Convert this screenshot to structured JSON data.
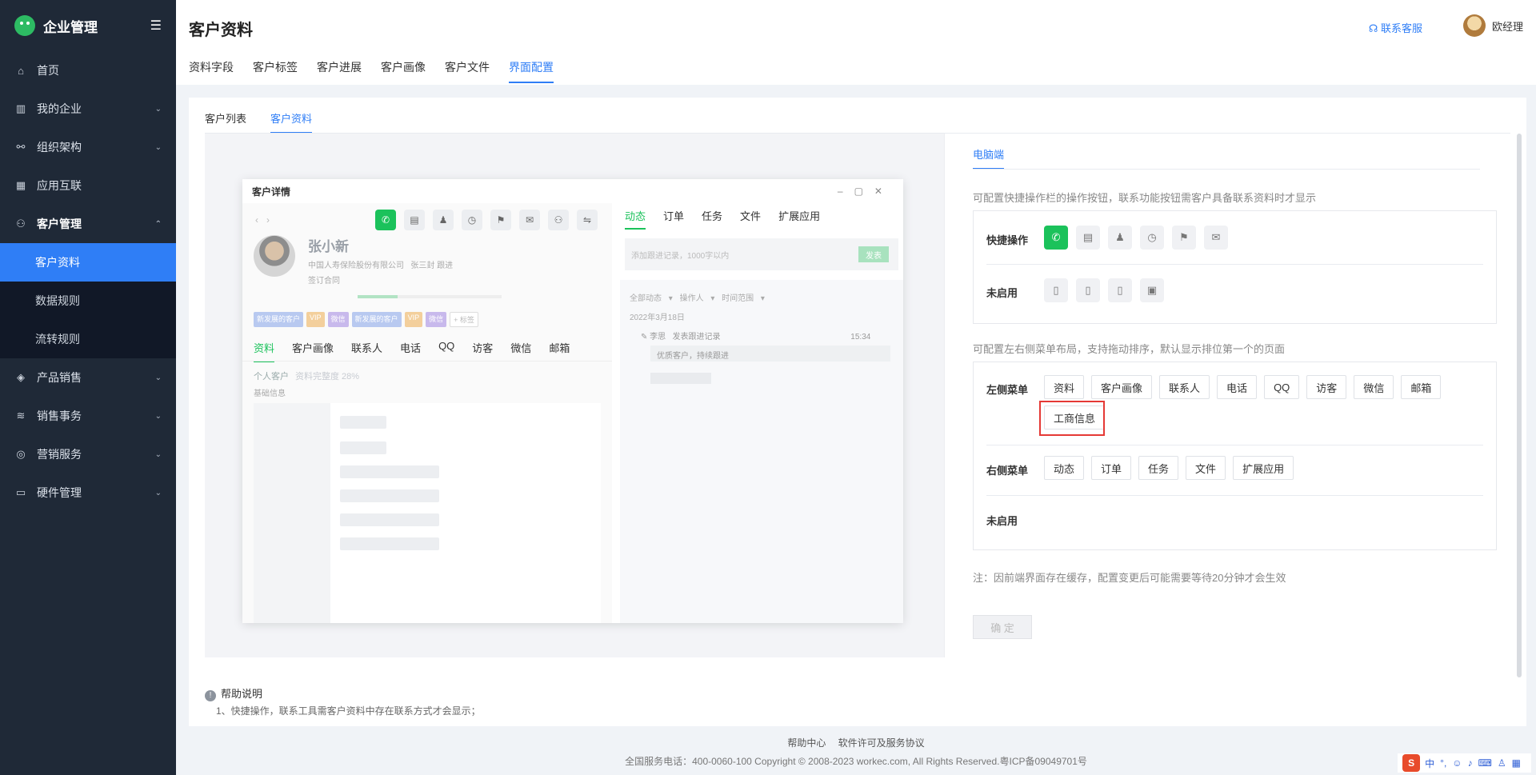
{
  "app": {
    "name": "企业管理"
  },
  "sidebar": {
    "items": [
      {
        "label": "首页",
        "icon": "home-icon"
      },
      {
        "label": "我的企业",
        "icon": "building-icon",
        "caret": "⌄"
      },
      {
        "label": "组织架构",
        "icon": "org-icon",
        "caret": "⌄"
      },
      {
        "label": "应用互联",
        "icon": "apps-icon"
      },
      {
        "label": "客户管理",
        "icon": "user-icon",
        "caret": "⌃"
      }
    ],
    "sub_items": [
      {
        "label": "客户资料",
        "active": true
      },
      {
        "label": "数据规则"
      },
      {
        "label": "流转规则"
      }
    ],
    "more_items": [
      {
        "label": "产品销售",
        "icon": "box-icon",
        "caret": "⌄"
      },
      {
        "label": "销售事务",
        "icon": "layers-icon",
        "caret": "⌄"
      },
      {
        "label": "营销服务",
        "icon": "marketing-icon",
        "caret": "⌄"
      },
      {
        "label": "硬件管理",
        "icon": "hardware-icon",
        "caret": "⌄"
      }
    ]
  },
  "header": {
    "title": "客户资料",
    "tabs": [
      "资料字段",
      "客户标签",
      "客户进展",
      "客户画像",
      "客户文件",
      "界面配置"
    ],
    "active_tab": "界面配置",
    "service_label": "联系客服",
    "user_name": "欧经理"
  },
  "subtabs": [
    "客户列表",
    "客户资料"
  ],
  "preview": {
    "window_title": "客户详情",
    "customer_name": "张小新",
    "company": "中国人寿保险股份有限公司",
    "owner": "张三封 跟进",
    "stage": "签订合同",
    "tags": [
      "新发展的客户",
      "VIP",
      "微信",
      "新发展的客户",
      "VIP",
      "微信",
      "+ 标签"
    ],
    "left_tabs": [
      "资料",
      "客户画像",
      "联系人",
      "电话",
      "QQ",
      "访客",
      "微信",
      "邮箱"
    ],
    "person_type": "个人客户",
    "completeness": "资料完整度 28%",
    "completeness_pct": 0.28,
    "base_info": "基础信息",
    "right_tabs": [
      "动态",
      "订单",
      "任务",
      "文件",
      "扩展应用"
    ],
    "input_placeholder": "添加跟进记录，1000字以内",
    "send_label": "发表",
    "filters": "全部动态 ▾ 操作人 ▾ 时间范围 ▾",
    "date": "2022年3月18日",
    "entry_author": "李思",
    "entry_action": "发表跟进记录",
    "entry_time": "15:34",
    "entry_text": "优质客户，持续跟进"
  },
  "config": {
    "platform_tab": "电脑端",
    "desc1": "可配置快捷操作栏的操作按钮，联系功能按钮需客户具备联系资料时才显示",
    "quick_label": "快捷操作",
    "unused_label": "未启用",
    "desc2": "可配置左右侧菜单布局，支持拖动排序，默认显示排位第一个的页面",
    "left_menu_label": "左侧菜单",
    "left_menu": [
      "资料",
      "客户画像",
      "联系人",
      "电话",
      "QQ",
      "访客",
      "微信",
      "邮箱",
      "工商信息"
    ],
    "right_menu_label": "右侧菜单",
    "right_menu": [
      "动态",
      "订单",
      "任务",
      "文件",
      "扩展应用"
    ],
    "unused_label2": "未启用",
    "note": "注：因前端界面存在缓存，配置变更后可能需要等待20分钟才会生效",
    "confirm_label": "确 定"
  },
  "help": {
    "title": "帮助说明",
    "line1": "1、快捷操作，联系工具需客户资料中存在联系方式才会显示；"
  },
  "footer": {
    "links": [
      "帮助中心",
      "软件许可及服务协议"
    ],
    "copyright": "全国服务电话：400-0060-100 Copyright © 2008-2023 workec.com, All Rights Reserved.粤ICP备09049701号"
  },
  "ime": {
    "logo": "S",
    "mode": "中"
  },
  "colors": {
    "primary": "#2f7ef6",
    "green": "#1bc25b",
    "sidebar": "#1f2937",
    "highlight": "#e53935"
  }
}
